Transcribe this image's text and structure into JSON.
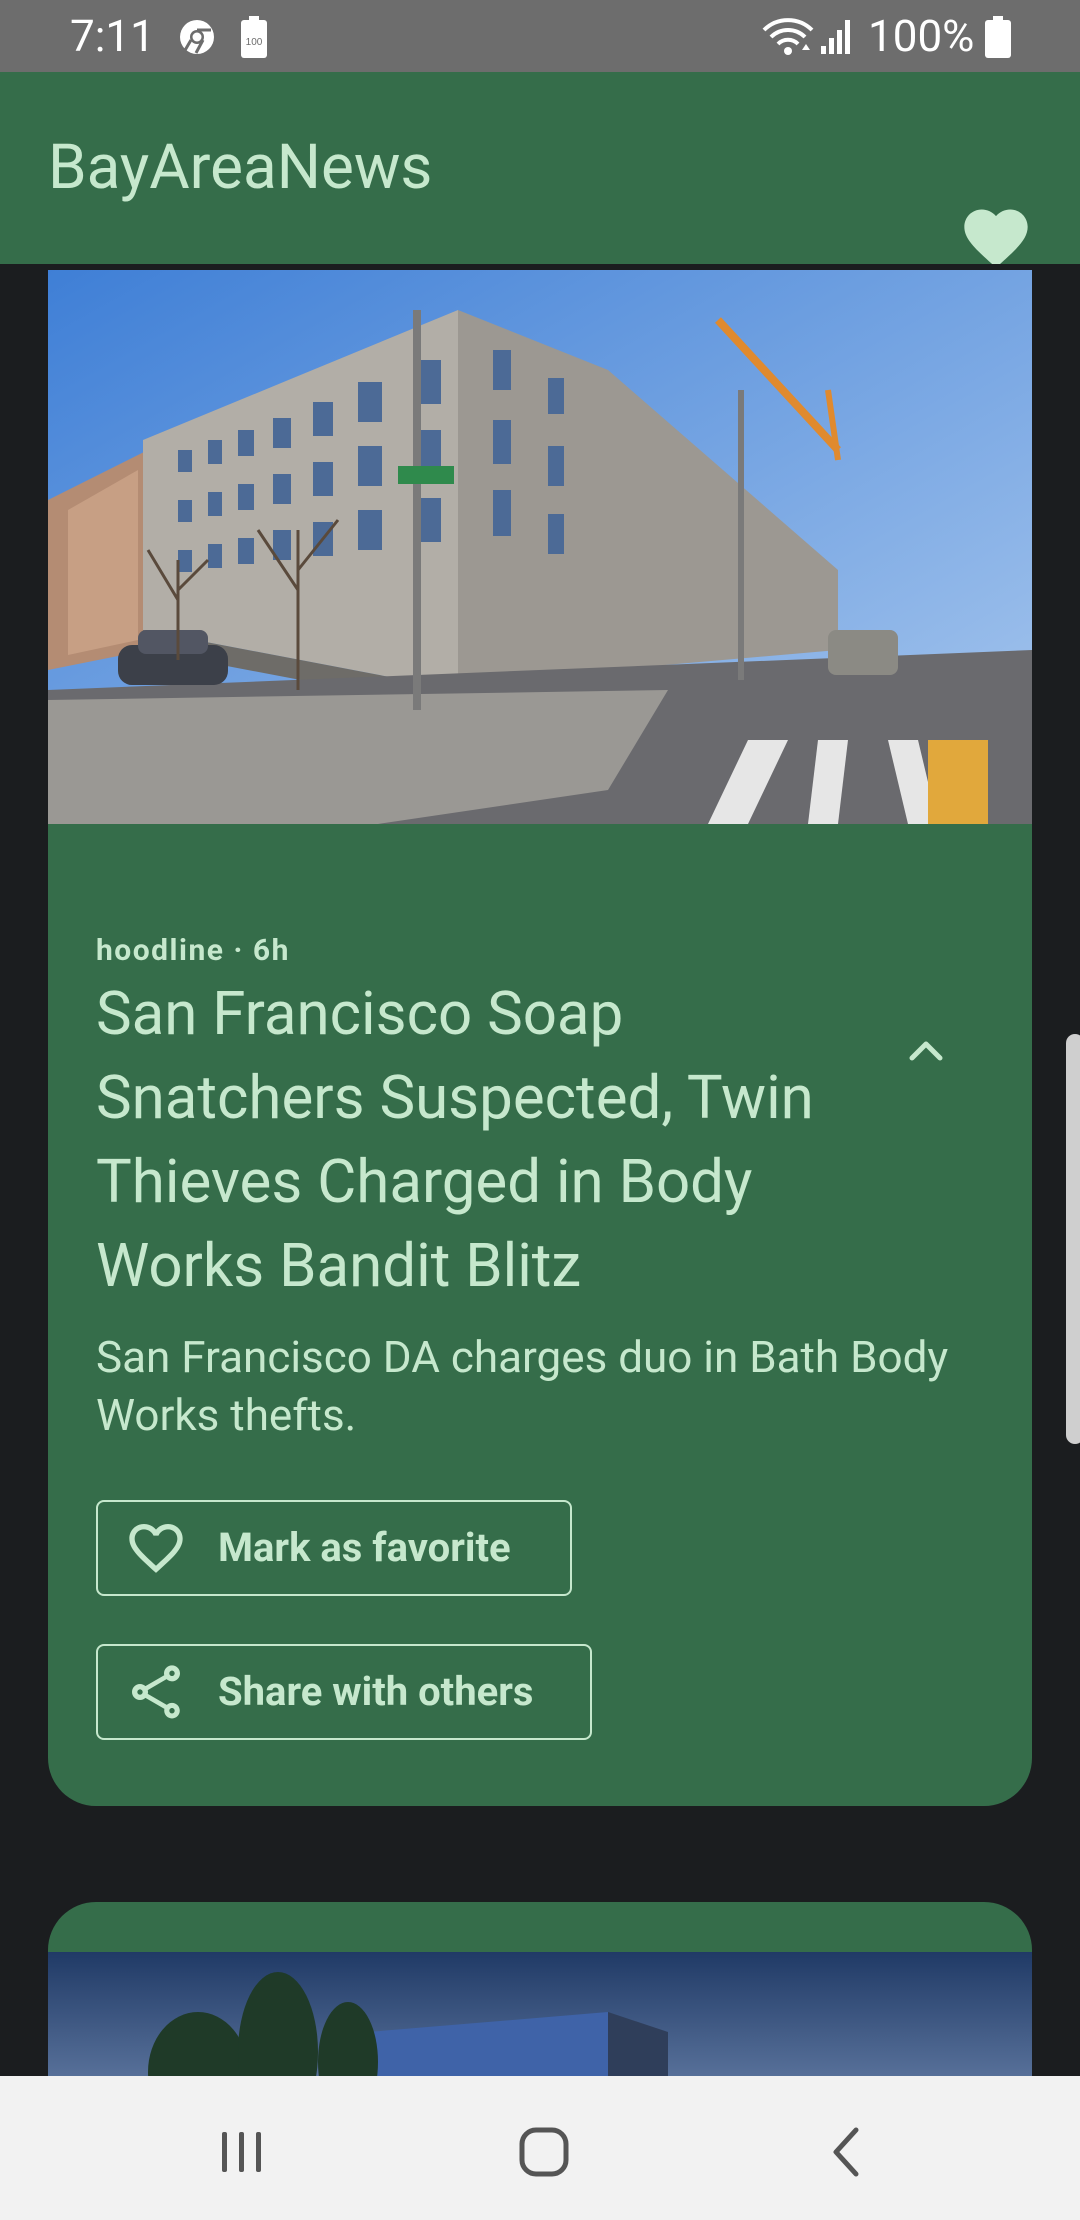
{
  "status_bar": {
    "time": "7:11",
    "battery_percent": "100%",
    "icons": [
      "chrome-icon",
      "battery-saver-icon",
      "wifi-icon",
      "signal-icon",
      "battery-icon"
    ]
  },
  "app_bar": {
    "title": "BayAreaNews",
    "action_icon": "heart-icon"
  },
  "feed": {
    "articles": [
      {
        "source_time": "hoodline · 6h",
        "headline": "San Francisco Soap Snatchers Suspected, Twin Thieves Charged in Body Works Bandit Blitz",
        "summary": "San Francisco DA charges duo in Bath Body Works thefts.",
        "expanded": true,
        "favorite_label": "Mark as favorite",
        "share_label": "Share with others"
      },
      {
        "partial": true
      }
    ]
  },
  "nav_bar": {
    "buttons": [
      "recent-apps",
      "home",
      "back"
    ]
  },
  "colors": {
    "status_bar": "#6d6d6d",
    "app_bar": "#356d4a",
    "card": "#356d4a",
    "accent_text": "#c6e8cd",
    "background": "#1b1d1f",
    "nav_bar": "#f2f2f2"
  }
}
